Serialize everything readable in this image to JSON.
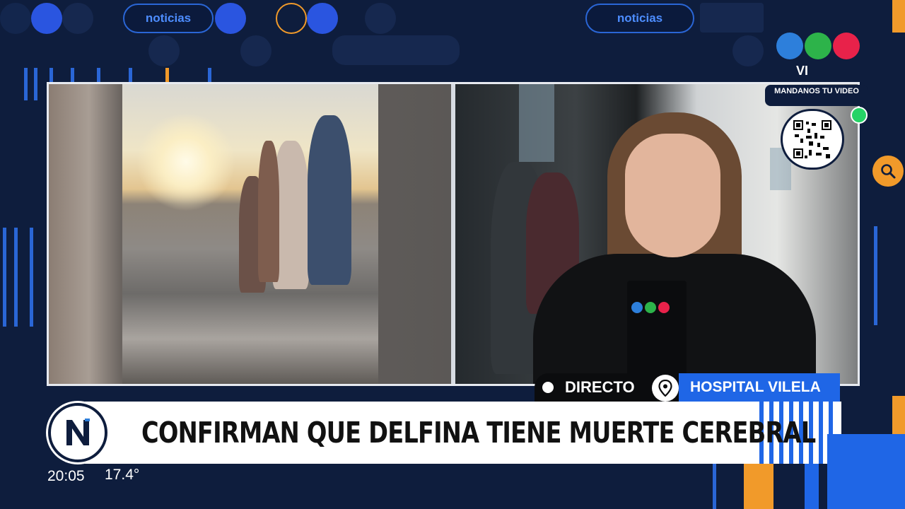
{
  "colors": {
    "background": "#0e1d3d",
    "accent_blue": "#1f66e6",
    "accent_orange": "#f19a2a",
    "logo_blue": "#2d7fdb",
    "logo_green": "#2db34a",
    "logo_red": "#e8224a",
    "whatsapp": "#25d366"
  },
  "top_pills": [
    "noticias",
    "noticias"
  ],
  "channel": {
    "logo_text": "VI",
    "cta": "MANDANOS TU VIDEO"
  },
  "lower_third": {
    "live_label": "DIRECTO",
    "location": "HOSPITAL VILELA",
    "headline": "CONFIRMAN QUE DELFINA TIENE MUERTE CEREBRAL"
  },
  "status": {
    "time": "20:05",
    "temperature": "17.4°"
  },
  "icons": {
    "search": "search-icon",
    "location": "location-pin-icon",
    "whatsapp": "whatsapp-icon",
    "qr": "qr-code-icon",
    "brand": "n-logo-icon"
  }
}
